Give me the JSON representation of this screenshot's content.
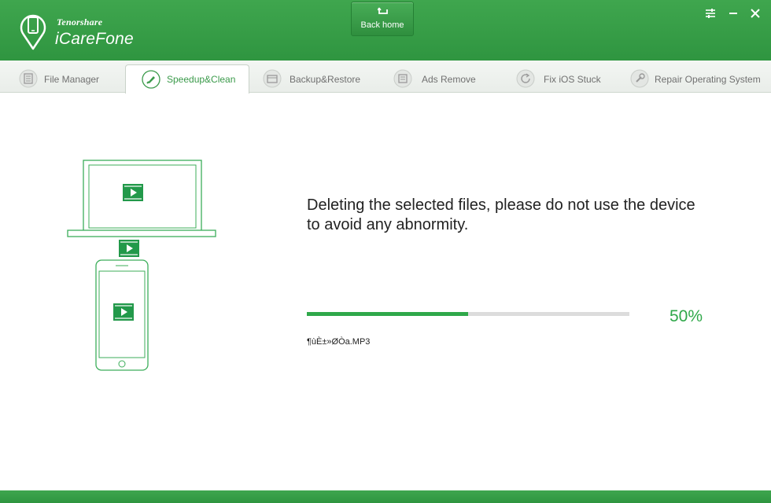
{
  "header": {
    "brand_small": "Tenorshare",
    "brand_big": "iCareFone",
    "back_home_label": "Back home",
    "window_buttons": [
      "menu-icon",
      "minimize-icon",
      "close-icon"
    ]
  },
  "tabs": [
    {
      "label": "File Manager",
      "icon": "file-manager-icon",
      "active": false
    },
    {
      "label": "Speedup&Clean",
      "icon": "brush-icon",
      "active": true
    },
    {
      "label": "Backup&Restore",
      "icon": "backup-icon",
      "active": false
    },
    {
      "label": "Ads Remove",
      "icon": "ads-remove-icon",
      "active": false
    },
    {
      "label": "Fix iOS Stuck",
      "icon": "refresh-icon",
      "active": false
    },
    {
      "label": "Repair Operating System",
      "icon": "wrench-icon",
      "active": false
    }
  ],
  "main": {
    "message_line1": "Deleting the selected files, please do not use the device",
    "message_line2": "to avoid any abnormity.",
    "progress": 0.5,
    "progress_text": "50%",
    "current_file": "¶ùÈ±»ØÒa.MP3"
  },
  "colors": {
    "brand_green": "#2f9540",
    "accent_green": "#2fa84a",
    "track_gray": "#dcdcdc"
  }
}
